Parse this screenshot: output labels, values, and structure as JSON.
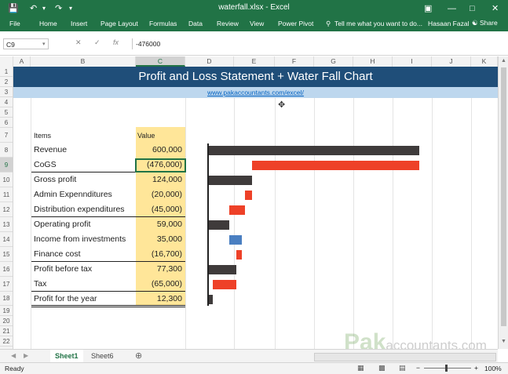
{
  "window": {
    "title": "waterfall.xlsx - Excel",
    "user": "Hasaan Fazal",
    "share_label": "Share",
    "tell_me": "Tell me what you want to do..."
  },
  "ribbon": {
    "tabs": [
      "File",
      "Home",
      "Insert",
      "Page Layout",
      "Formulas",
      "Data",
      "Review",
      "View",
      "Power Pivot"
    ]
  },
  "formula_bar": {
    "name_box": "C9",
    "formula": "-476000"
  },
  "columns": [
    "A",
    "B",
    "C",
    "D",
    "E",
    "F",
    "G",
    "H",
    "I",
    "J",
    "K"
  ],
  "selected_column": "C",
  "rows": [
    "1",
    "2",
    "3",
    "4",
    "5",
    "6",
    "7",
    "8",
    "9",
    "10",
    "11",
    "12",
    "13",
    "14",
    "15",
    "16",
    "17",
    "18",
    "19",
    "20",
    "21",
    "22"
  ],
  "selected_row": "9",
  "sheet": {
    "title": "Profit and Loss Statement + Water Fall Chart",
    "link": "www.pakaccountants.com/excel/",
    "header_items": "Items",
    "header_value": "Value",
    "items": [
      {
        "label": "Revenue",
        "value": "600,000"
      },
      {
        "label": "CoGS",
        "value": "(476,000)"
      },
      {
        "label": "Gross profit",
        "value": "124,000"
      },
      {
        "label": "Admin Expennditures",
        "value": "(20,000)"
      },
      {
        "label": "Distribution expenditures",
        "value": "(45,000)"
      },
      {
        "label": "Operating profit",
        "value": "59,000"
      },
      {
        "label": "Income from investments",
        "value": "35,000"
      },
      {
        "label": "Finance cost",
        "value": "(16,700)"
      },
      {
        "label": "Profit before tax",
        "value": "77,300"
      },
      {
        "label": "Tax",
        "value": "(65,000)"
      },
      {
        "label": "Profit for the year",
        "value": "12,300"
      }
    ]
  },
  "chart_data": {
    "type": "bar",
    "categories": [
      "Revenue",
      "CoGS",
      "Gross profit",
      "Admin Expennditures",
      "Distribution expenditures",
      "Operating profit",
      "Income from investments",
      "Finance cost",
      "Profit before tax",
      "Tax",
      "Profit for the year"
    ],
    "values": [
      600000,
      -476000,
      124000,
      -20000,
      -45000,
      59000,
      35000,
      -16700,
      77300,
      -65000,
      12300
    ],
    "bar_kind": [
      "total",
      "decrease",
      "total",
      "decrease",
      "decrease",
      "total",
      "increase",
      "decrease",
      "total",
      "decrease",
      "total"
    ],
    "colors": {
      "total": "#3f3b3b",
      "decrease": "#ee4128",
      "increase": "#4a7fc1"
    },
    "xlim": [
      0,
      600000
    ]
  },
  "sheet_tabs": [
    "Sheet1",
    "Sheet6"
  ],
  "active_sheet": "Sheet1",
  "status": {
    "ready": "Ready",
    "zoom": "100%"
  },
  "watermark": {
    "bold": "Pak",
    "rest": "accountants.com"
  },
  "accent_color": "#217346"
}
